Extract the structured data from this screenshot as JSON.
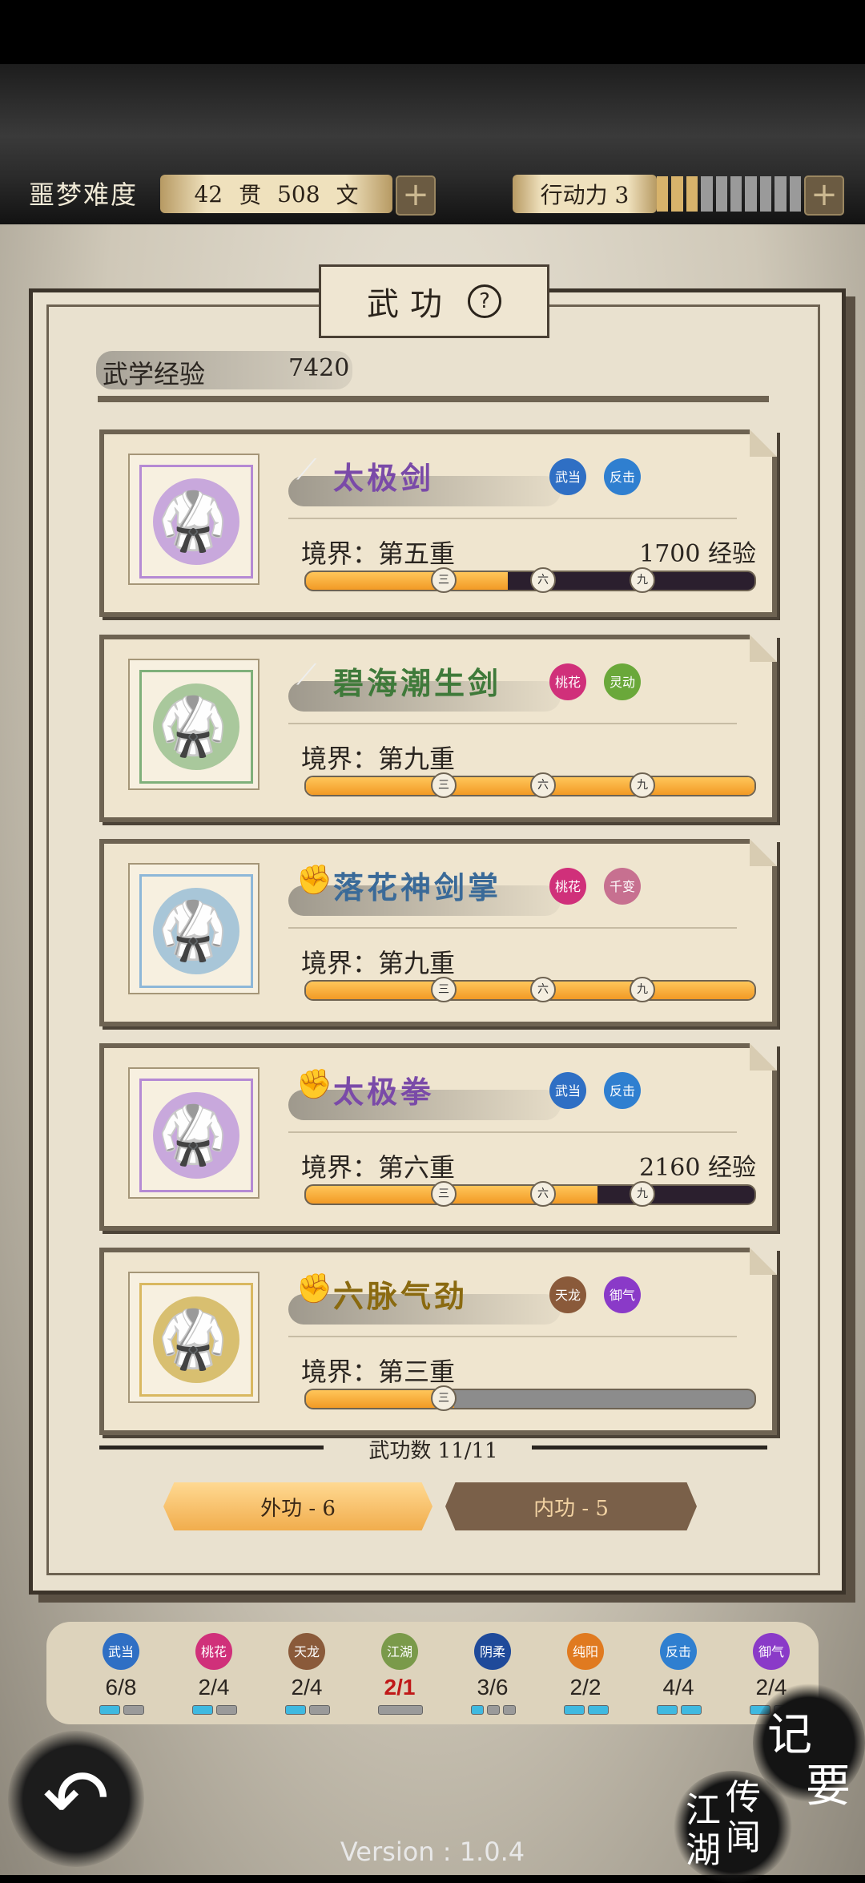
{
  "header": {
    "difficulty": "噩梦难度",
    "money_guan": "42",
    "money_guan_unit": "贯",
    "money_wen": "508",
    "money_wen_unit": "文",
    "action_points_label": "行动力 3",
    "action_points_level": 3,
    "action_points_max": 10
  },
  "panel": {
    "title": "武功",
    "help_icon": "question-circle-icon",
    "exp_label": "武学经验",
    "exp_value": "7420",
    "count_label": "武功数 11/11"
  },
  "skills": [
    {
      "name": "太极剑",
      "type_icon": "sword-icon",
      "name_color": "#7a4aa8",
      "frame_color": "#b58ad4",
      "circle_color": "#c8a8dc",
      "badges": [
        {
          "text": "武当",
          "color": "#2f6fc4"
        },
        {
          "text": "反击",
          "color": "#2f7fd0"
        }
      ],
      "level": "境界：第五重",
      "exp": "1700 经验",
      "progress": 0.45
    },
    {
      "name": "碧海潮生剑",
      "type_icon": "sword-icon",
      "name_color": "#3f7a3a",
      "frame_color": "#7fb07a",
      "circle_color": "#a9c89c",
      "badges": [
        {
          "text": "桃花",
          "color": "#d0307a"
        },
        {
          "text": "灵动",
          "color": "#6aa83a"
        }
      ],
      "level": "境界：第九重",
      "exp": "",
      "progress": 1.0
    },
    {
      "name": "落花神剑掌",
      "type_icon": "fist-icon",
      "name_color": "#3a6a98",
      "frame_color": "#8db7d8",
      "circle_color": "#a8c6d8",
      "badges": [
        {
          "text": "桃花",
          "color": "#d0307a"
        },
        {
          "text": "千变",
          "color": "#c77090"
        }
      ],
      "level": "境界：第九重",
      "exp": "",
      "progress": 1.0
    },
    {
      "name": "太极拳",
      "type_icon": "fist-icon",
      "name_color": "#7a4aa8",
      "frame_color": "#b58ad4",
      "circle_color": "#c8a8dc",
      "badges": [
        {
          "text": "武当",
          "color": "#2f6fc4"
        },
        {
          "text": "反击",
          "color": "#2f7fd0"
        }
      ],
      "level": "境界：第六重",
      "exp": "2160 经验",
      "progress": 0.65
    },
    {
      "name": "六脉气劲",
      "type_icon": "fist-icon",
      "name_color": "#8a6a10",
      "frame_color": "#d9b860",
      "circle_color": "#d8bf70",
      "badges": [
        {
          "text": "天龙",
          "color": "#8a5a3a"
        },
        {
          "text": "御气",
          "color": "#8a3ac8"
        }
      ],
      "level": "境界：第三重",
      "exp": "",
      "progress": 0.33,
      "track_gray": true
    }
  ],
  "marks": [
    "三",
    "六",
    "九"
  ],
  "tabs": {
    "outer": "外功 - 6",
    "inner": "内功 - 5"
  },
  "stats": [
    {
      "text": "武当",
      "color": "#2f6fc4",
      "value": "6/8",
      "pips": 2,
      "on": 1
    },
    {
      "text": "桃花",
      "color": "#d0307a",
      "value": "2/4",
      "pips": 2,
      "on": 1
    },
    {
      "text": "天龙",
      "color": "#8a5a3a",
      "value": "2/4",
      "pips": 2,
      "on": 1
    },
    {
      "text": "江湖",
      "color": "#7a9a4a",
      "value": "2/1",
      "pips": 1,
      "on": 0,
      "red": true
    },
    {
      "text": "阴柔",
      "color": "#1f4a9a",
      "value": "3/6",
      "pips": 3,
      "on": 1
    },
    {
      "text": "纯阳",
      "color": "#e07a20",
      "value": "2/2",
      "pips": 2,
      "on": 2
    },
    {
      "text": "反击",
      "color": "#2f7fd0",
      "value": "4/4",
      "pips": 2,
      "on": 2
    },
    {
      "text": "御气",
      "color": "#8a3ac8",
      "value": "2/4",
      "pips": 2,
      "on": 1
    }
  ],
  "footer": {
    "notes_l1": "记",
    "notes_l2": "要",
    "rumors": [
      "传",
      "闻",
      "江",
      "湖"
    ],
    "version": "Version : 1.0.4",
    "back_icon": "back-arrow-icon"
  }
}
